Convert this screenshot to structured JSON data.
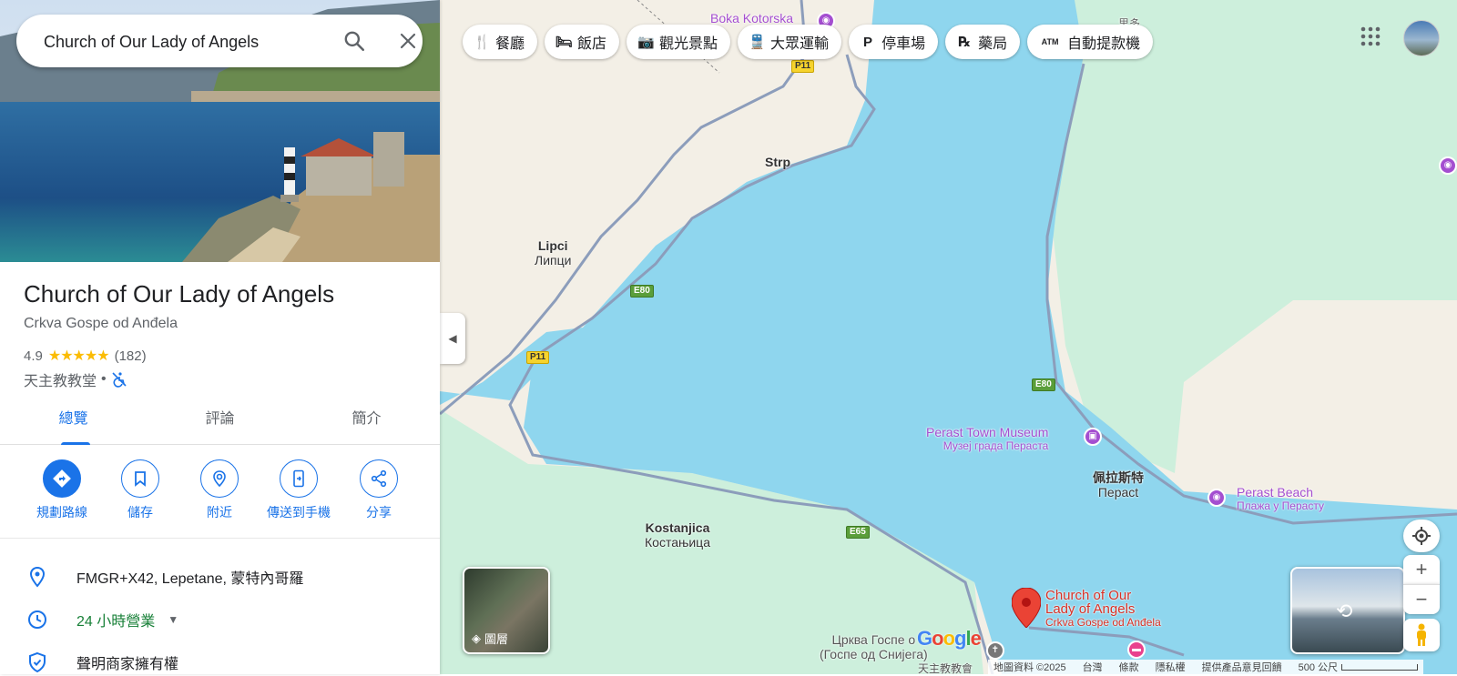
{
  "search": {
    "value": "Church of Our Lady of Angels"
  },
  "hero": {
    "image": "church-lighthouse-bay-photo"
  },
  "place": {
    "title": "Church of Our Lady of Angels",
    "subtitle": "Crkva Gospe od Anđela",
    "rating": "4.9",
    "stars": "★★★★★",
    "review_count": "(182)",
    "category": "天主教教堂",
    "separator": "•",
    "accessibility_icon": "no-wheelchair-icon"
  },
  "tabs": [
    {
      "label": "總覽",
      "active": true
    },
    {
      "label": "評論",
      "active": false
    },
    {
      "label": "簡介",
      "active": false
    }
  ],
  "actions": [
    {
      "label": "規劃路線",
      "icon": "directions-icon"
    },
    {
      "label": "儲存",
      "icon": "bookmark-icon"
    },
    {
      "label": "附近",
      "icon": "nearby-icon"
    },
    {
      "label": "傳送到手機",
      "icon": "send-to-phone-icon"
    },
    {
      "label": "分享",
      "icon": "share-icon"
    }
  ],
  "info": {
    "address": "FMGR+X42, Lepetane, 蒙特內哥羅",
    "hours": "24 小時營業",
    "claim": "聲明商家擁有權"
  },
  "chips": [
    {
      "label": "餐廳",
      "icon": "restaurant-icon",
      "glyph": "🍴"
    },
    {
      "label": "飯店",
      "icon": "hotel-icon",
      "glyph": "🛏"
    },
    {
      "label": "觀光景點",
      "icon": "camera-icon",
      "glyph": "📷"
    },
    {
      "label": "大眾運輸",
      "icon": "transit-icon",
      "glyph": "🚆"
    },
    {
      "label": "停車場",
      "icon": "parking-icon",
      "glyph": "P"
    },
    {
      "label": "藥局",
      "icon": "pharmacy-icon",
      "glyph": "℞"
    },
    {
      "label": "自動提款機",
      "icon": "atm-icon",
      "glyph": "ATM"
    }
  ],
  "map": {
    "places": {
      "strp": "Strp",
      "lipci": "Lipci",
      "lipci_cyr": "Липци",
      "kostanjica": "Kostanjica",
      "kostanjica_cyr": "Костањица",
      "perast": "佩拉斯特",
      "perast_cyr": "Перасt",
      "church_cyr": "Црква Госпе од Снијега",
      "church_cyr_prefix": "Црква Госпе о",
      "church_cyr_suffix": "(Госпе од Снијега)",
      "catholic_label": "天主教教會"
    },
    "pois": {
      "boka": "Boka Kotorska",
      "museum": "Perast Town Museum",
      "museum_cyr": "Музеј града Пераста",
      "beach": "Perast Beach",
      "beach_cyr": "Плажа у Перасту",
      "top_right_cjk": "里多"
    },
    "pin": {
      "line1": "Church of Our",
      "line2": "Lady of Angels",
      "sub": "Crkva Gospe od Anđela"
    },
    "roads": {
      "p11": "P11",
      "e80": "E80",
      "e65": "E65"
    },
    "layers_label": "圖層",
    "logo": "Google",
    "attribution": {
      "data": "地圖資料 ©2025",
      "region": "台灣",
      "terms": "條款",
      "privacy": "隱私權",
      "feedback": "提供產品意見回饋",
      "scale": "500 公尺"
    },
    "colors": {
      "water": "#8fd6ee",
      "land": "#f3efe6",
      "park": "#c9eed9",
      "road": "#8c9dbb",
      "accent": "#1a73e8",
      "poi": "#a44ed0"
    }
  }
}
